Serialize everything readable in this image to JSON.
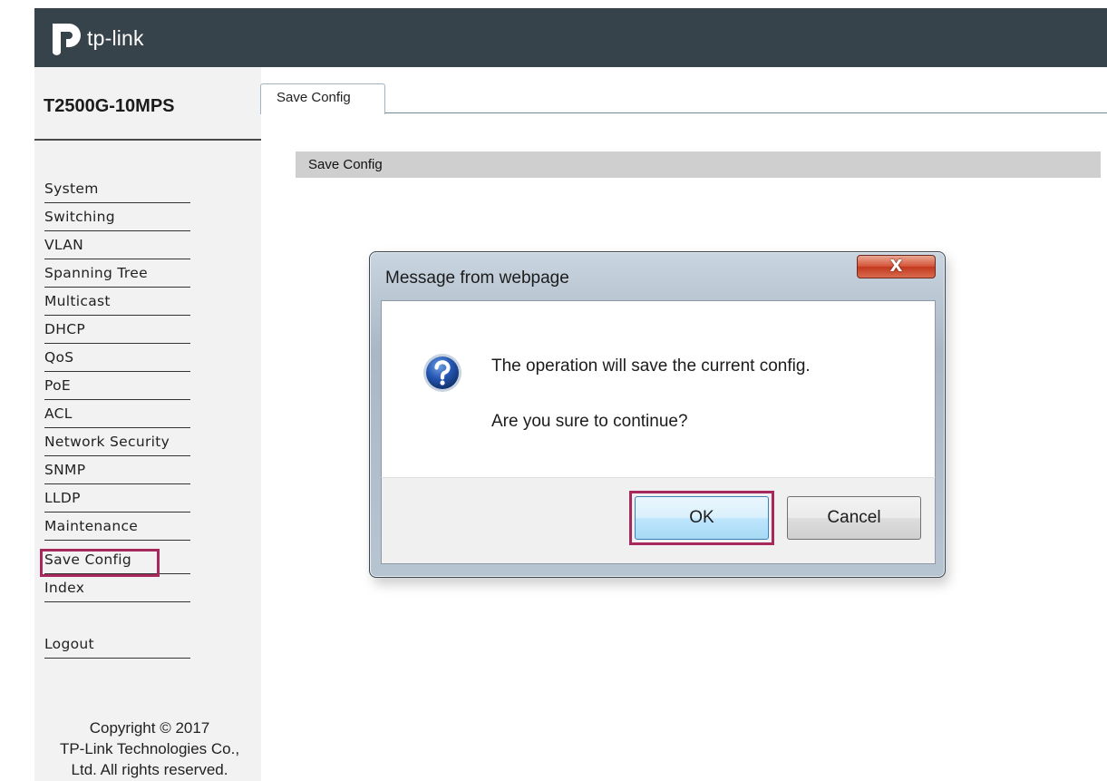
{
  "brand": {
    "logo_text": "tp-link"
  },
  "sidebar": {
    "model": "T2500G-10MPS",
    "items": [
      {
        "label": "System"
      },
      {
        "label": "Switching"
      },
      {
        "label": "VLAN"
      },
      {
        "label": "Spanning Tree"
      },
      {
        "label": "Multicast"
      },
      {
        "label": "DHCP"
      },
      {
        "label": "QoS"
      },
      {
        "label": "PoE"
      },
      {
        "label": "ACL"
      },
      {
        "label": "Network Security"
      },
      {
        "label": "SNMP"
      },
      {
        "label": "LLDP"
      },
      {
        "label": "Maintenance"
      },
      {
        "label": "Save Config"
      },
      {
        "label": "Index"
      }
    ],
    "selected": "Save Config",
    "logout": "Logout",
    "copyright": [
      "Copyright © 2017",
      "TP-Link Technologies Co.,",
      "Ltd. All rights reserved."
    ]
  },
  "main": {
    "tab_label": "Save Config",
    "section_title": "Save Config"
  },
  "dialog": {
    "title": "Message from webpage",
    "close_glyph": "X",
    "icon": "question-icon",
    "message_line1": "The operation will save the current config.",
    "message_line2": "Are you sure to continue?",
    "ok_label": "OK",
    "cancel_label": "Cancel"
  },
  "colors": {
    "header_bg": "#37434b",
    "sidebar_bg": "#f2f2f2",
    "highlight": "#a7285a",
    "section_bar": "#cfcfcf"
  }
}
